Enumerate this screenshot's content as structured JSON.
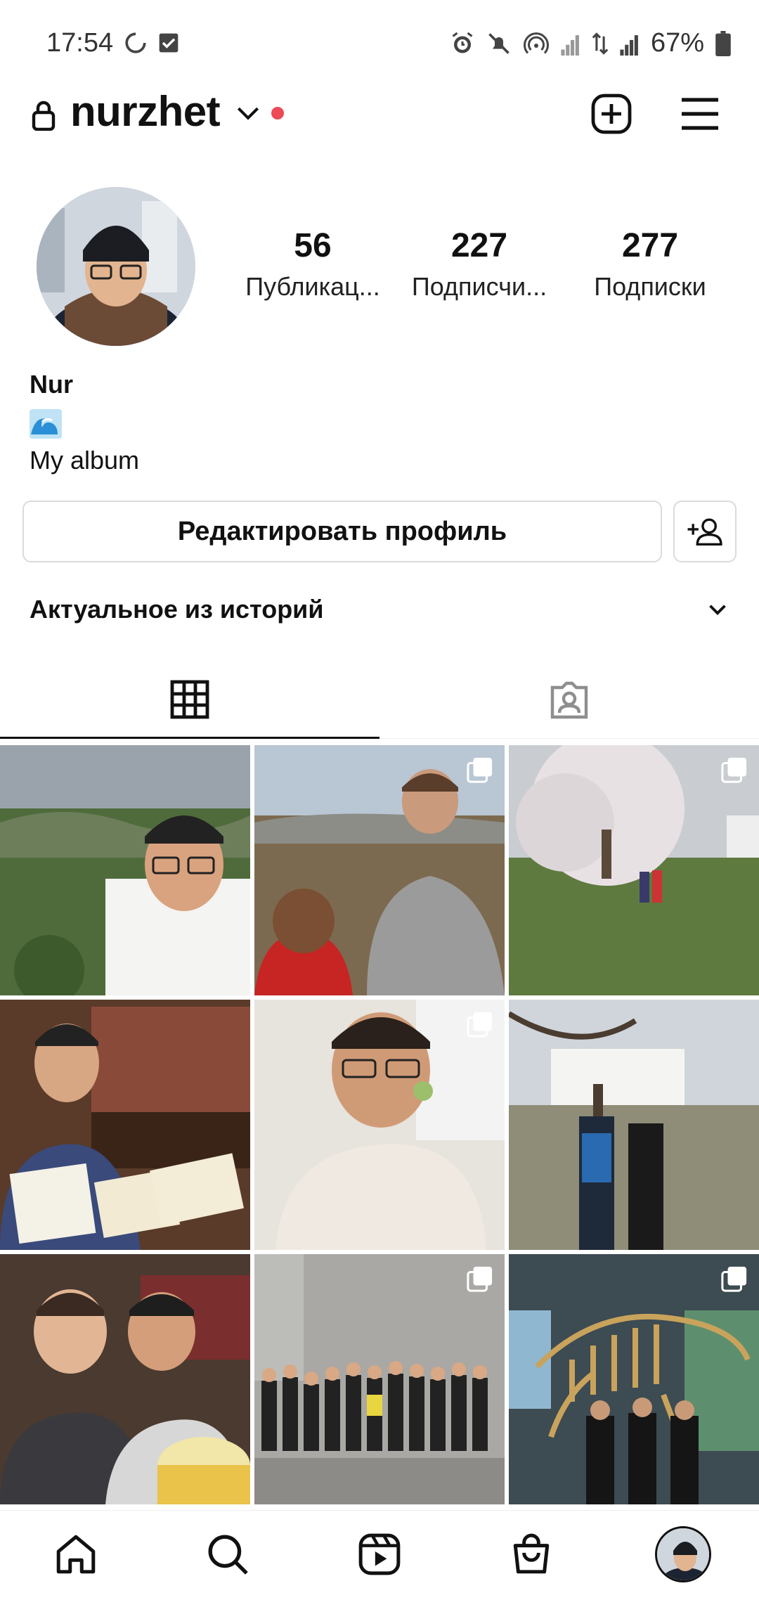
{
  "status_bar": {
    "time": "17:54",
    "battery": "67%"
  },
  "header": {
    "username": "nurzhet"
  },
  "profile": {
    "stats": [
      {
        "count": "56",
        "label": "Публикац..."
      },
      {
        "count": "227",
        "label": "Подписчи..."
      },
      {
        "count": "277",
        "label": "Подписки"
      }
    ],
    "name": "Nur",
    "bio_emoji": "wave-emoji",
    "bio_text": "My album"
  },
  "buttons": {
    "edit_profile": "Редактировать профиль"
  },
  "highlights": {
    "title": "Актуальное из историй"
  },
  "tabs": [
    {
      "icon": "grid-icon",
      "active": true
    },
    {
      "icon": "tagged-icon",
      "active": false
    }
  ],
  "grid": {
    "posts": [
      {
        "scene": "mountain-selfie",
        "multi": false
      },
      {
        "scene": "valley-view",
        "multi": true
      },
      {
        "scene": "blossom-tree",
        "multi": true
      },
      {
        "scene": "certificate",
        "multi": false
      },
      {
        "scene": "portrait-smile",
        "multi": true
      },
      {
        "scene": "capitol-friends",
        "multi": false
      },
      {
        "scene": "cinema-popcorn",
        "multi": false
      },
      {
        "scene": "nasa-group",
        "multi": true
      },
      {
        "scene": "museum-skeleton",
        "multi": true
      }
    ]
  },
  "colors": {
    "notification_dot": "#ed4956",
    "border": "#dbdbdb"
  },
  "bottom_nav": [
    "home-icon",
    "search-icon",
    "reels-icon",
    "shop-icon",
    "profile-avatar"
  ]
}
